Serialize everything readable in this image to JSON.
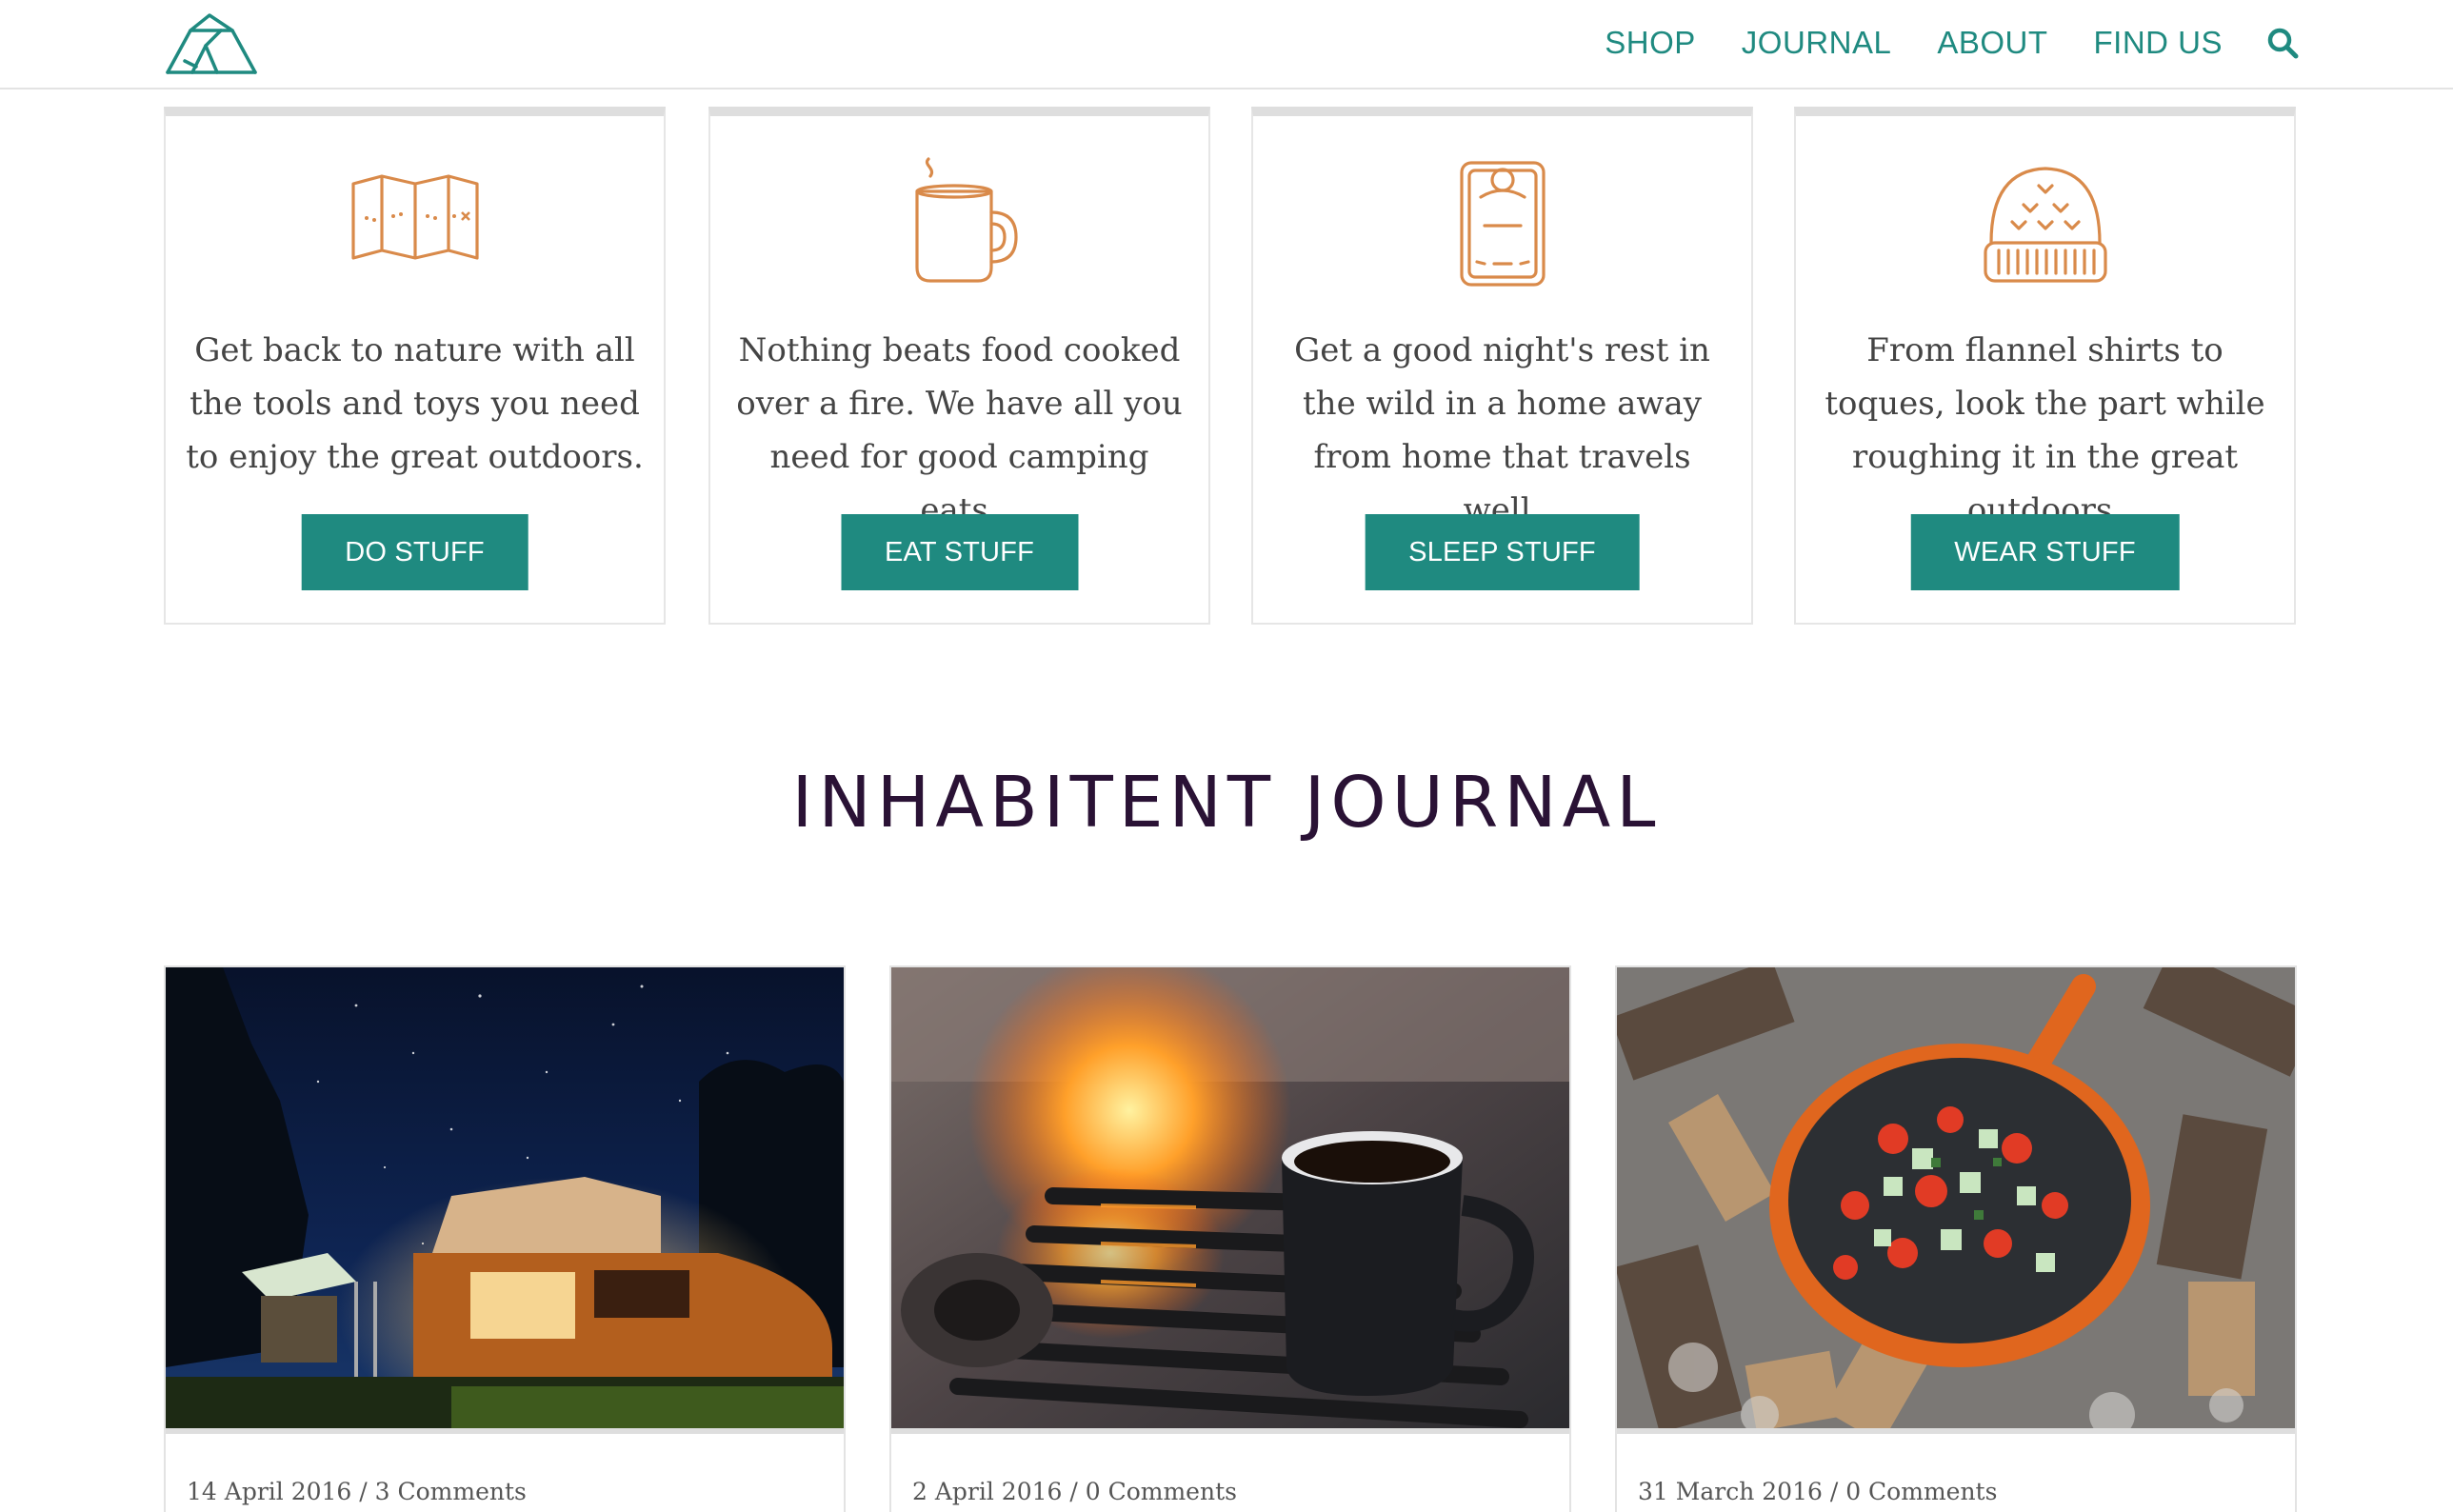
{
  "header": {
    "logo": "tent-logo",
    "nav": [
      "SHOP",
      "JOURNAL",
      "ABOUT",
      "FIND US"
    ],
    "search_icon": "search-icon"
  },
  "categories": [
    {
      "icon": "map-icon",
      "text": "Get back to nature with all the tools and toys you need to enjoy the great outdoors.",
      "button": "DO STUFF"
    },
    {
      "icon": "mug-icon",
      "text": "Nothing beats food cooked over a fire. We have all you need for good camping eats.",
      "button": "EAT STUFF"
    },
    {
      "icon": "sleeping-bag-icon",
      "text": "Get a good night's rest in the wild in a home away from home that travels well.",
      "button": "SLEEP STUFF"
    },
    {
      "icon": "toque-icon",
      "text": "From flannel shirts to toques, look the part while roughing it in the great outdoors.",
      "button": "WEAR STUFF"
    }
  ],
  "journal": {
    "title": "INHABITENT JOURNAL",
    "posts": [
      {
        "image": "camper-van-night-photo",
        "meta": "14 April 2016 / 3 Comments"
      },
      {
        "image": "campfire-coffee-photo",
        "meta": "2 April 2016 / 0 Comments"
      },
      {
        "image": "skillet-over-fire-photo",
        "meta": "31 March 2016 / 0 Comments"
      }
    ]
  },
  "colors": {
    "accent": "#1f8a80",
    "icon": "#d98a4a",
    "heading": "#2a1235",
    "card_top": "#dedede"
  }
}
